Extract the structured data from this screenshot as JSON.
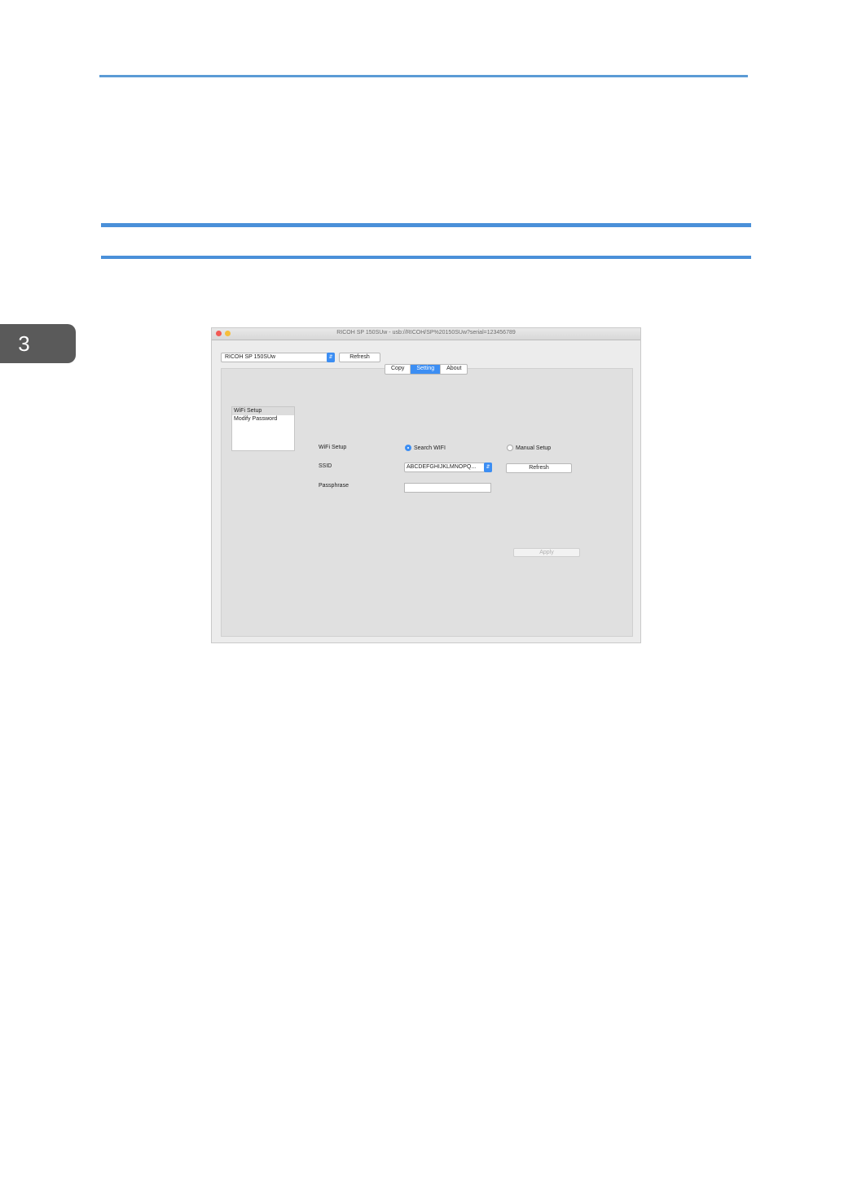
{
  "page": {
    "chapter_number": "3"
  },
  "window": {
    "title": "RICOH SP 150SUw - usb://RICOH/SP%20150SUw?serial=123456789",
    "device_select_value": "RICOH SP 150SUw",
    "refresh_label": "Refresh",
    "tabs": [
      {
        "label": "Copy",
        "active": false
      },
      {
        "label": "Setting",
        "active": true
      },
      {
        "label": "About",
        "active": false
      }
    ],
    "menu_items": [
      {
        "label": "WiFi Setup",
        "selected": true
      },
      {
        "label": "Modify Password",
        "selected": false
      }
    ],
    "wifi_setup_label": "WiFi Setup",
    "radio_search_label": "Search WIFI",
    "radio_search_checked": true,
    "radio_manual_label": "Manual Setup",
    "radio_manual_checked": false,
    "ssid_label": "SSID",
    "ssid_value": "ABCDEFGHIJKLMNOPQ...",
    "ssid_refresh_label": "Refresh",
    "passphrase_label": "Passphrase",
    "passphrase_value": "",
    "apply_label": "Apply",
    "colors": {
      "accent": "#3c8ef3",
      "rule": "#4a90d9"
    }
  }
}
